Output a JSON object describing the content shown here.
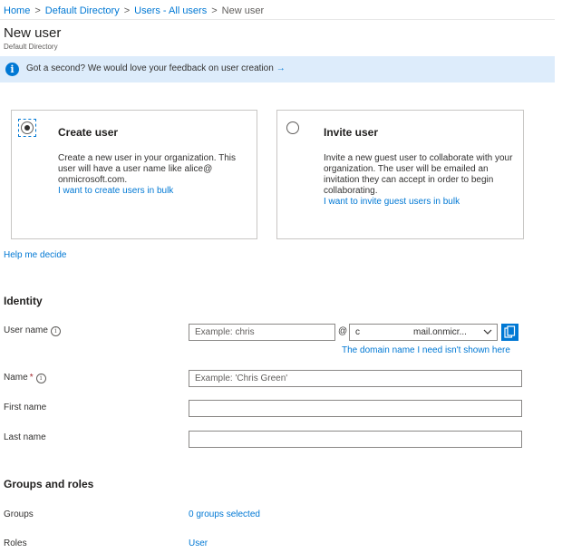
{
  "breadcrumb": {
    "items": [
      "Home",
      "Default Directory",
      "Users - All users"
    ],
    "current": "New user"
  },
  "header": {
    "title": "New user",
    "subtitle": "Default Directory"
  },
  "banner": {
    "text": "Got a second? We would love your feedback on user creation",
    "arrow": "→"
  },
  "create_card": {
    "title": "Create user",
    "selected": true,
    "description": "Create a new user in your organization. This user will have a user name like alice@         onmicrosoft.com.",
    "link": "I want to create users in bulk"
  },
  "invite_card": {
    "title": "Invite user",
    "selected": false,
    "description": "Invite a new guest user to collaborate with your organization. The user will be emailed an invitation they can accept in order to begin collaborating.",
    "link": "I want to invite guest users in bulk"
  },
  "help_link": "Help me decide",
  "identity": {
    "title": "Identity",
    "user_name": {
      "label": "User name",
      "placeholder": "Example: chris",
      "at": "@",
      "domain_prefix": "c",
      "domain_value": "mail.onmicr...",
      "domain_link": "The domain name I need isn't shown here"
    },
    "name": {
      "label": "Name",
      "required_mark": "*",
      "placeholder": "Example: 'Chris Green'"
    },
    "first_name": {
      "label": "First name",
      "value": ""
    },
    "last_name": {
      "label": "Last name",
      "value": ""
    }
  },
  "groups_roles": {
    "title": "Groups and roles",
    "groups": {
      "label": "Groups",
      "value": "0 groups selected"
    },
    "roles": {
      "label": "Roles",
      "value": "User"
    }
  },
  "icons": {
    "info": "info-circle-icon",
    "info_small": "info-small-icon",
    "chevron": "chevron-down-icon",
    "copy": "copy-icon"
  },
  "colors": {
    "accent": "#0078d4",
    "banner_bg": "#ddecfb",
    "required": "#a4262c"
  }
}
